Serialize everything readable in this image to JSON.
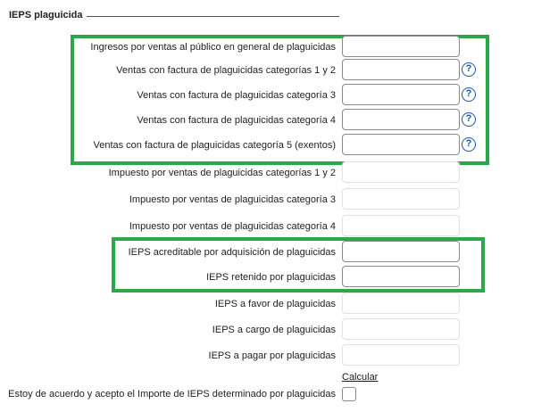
{
  "section": {
    "title": "IEPS plaguicida"
  },
  "fields": [
    {
      "label": "Ingresos por ventas al público en general de plaguicidas",
      "value": "",
      "help": false,
      "readonly": false
    },
    {
      "label": "Ventas con factura de plaguicidas categorías 1 y 2",
      "value": "",
      "help": true,
      "readonly": false
    },
    {
      "label": "Ventas con factura de plaguicidas categoría 3",
      "value": "",
      "help": true,
      "readonly": false
    },
    {
      "label": "Ventas con factura de plaguicidas categoría 4",
      "value": "",
      "help": true,
      "readonly": false
    },
    {
      "label": "Ventas con factura de plaguicidas categoría 5 (exentos)",
      "value": "",
      "help": true,
      "readonly": false
    },
    {
      "label": "Impuesto por ventas de plaguicidas categorías 1 y 2",
      "value": "",
      "help": false,
      "readonly": true
    },
    {
      "label": "Impuesto por ventas de plaguicidas categoría 3",
      "value": "",
      "help": false,
      "readonly": true
    },
    {
      "label": "Impuesto por ventas de plaguicidas categoría 4",
      "value": "",
      "help": false,
      "readonly": true
    },
    {
      "label": "IEPS acreditable por adquisición de plaguicidas",
      "value": "",
      "help": false,
      "readonly": false
    },
    {
      "label": "IEPS retenido por plaguicidas",
      "value": "",
      "help": false,
      "readonly": false
    },
    {
      "label": "IEPS a favor de plaguicidas",
      "value": "",
      "help": false,
      "readonly": true
    },
    {
      "label": "IEPS a cargo de plaguicidas",
      "value": "",
      "help": false,
      "readonly": true
    },
    {
      "label": "IEPS a pagar por plaguicidas",
      "value": "",
      "help": false,
      "readonly": true
    }
  ],
  "help_icon": {
    "icon": "question-circle-icon",
    "glyph": "?"
  },
  "calculate_link": "Calcular",
  "agreement": {
    "label": "Estoy de acuerdo y acepto el Importe de IEPS determinado por plaguicidas",
    "checked": false
  },
  "colors": {
    "highlight": "#2aa84a",
    "help": "#1c56a7"
  }
}
